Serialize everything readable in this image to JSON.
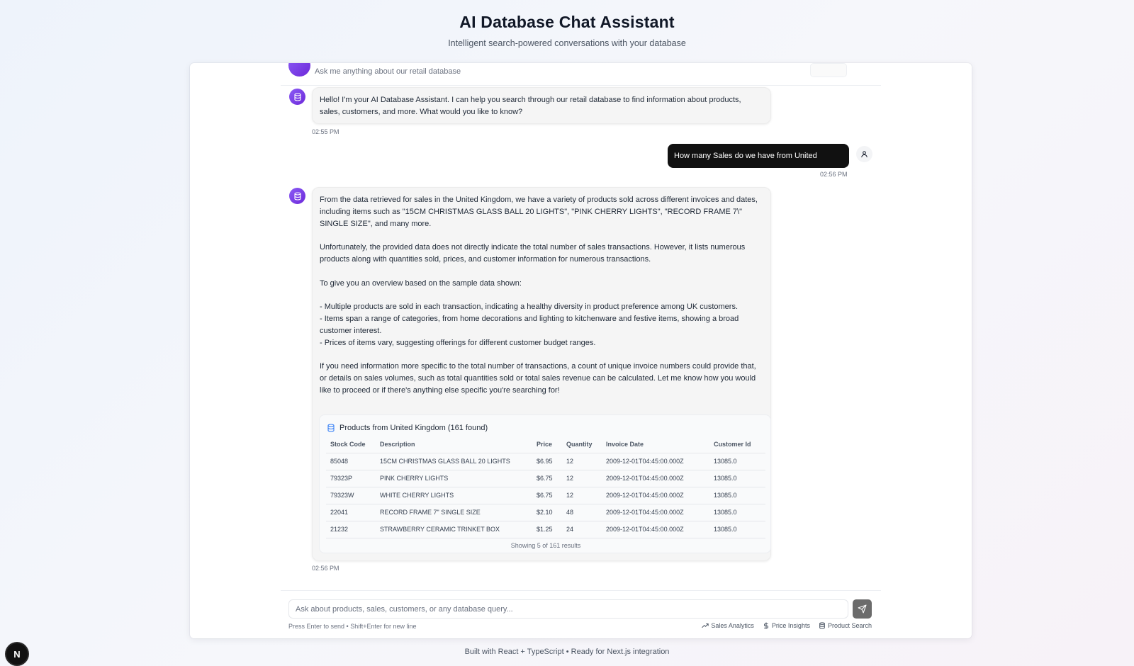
{
  "page": {
    "title": "AI Database Chat Assistant",
    "subtitle": "Intelligent search-powered conversations with your database",
    "footer": "Built with React + TypeScript • Ready for Next.js integration",
    "badge_letter": "N"
  },
  "chat_header": {
    "subtitle": "Ask me anything about our retail database"
  },
  "messages": {
    "greeting": {
      "text": "Hello! I'm your AI Database Assistant. I can help you search through our retail database to find information about products, sales, customers, and more. What would you like to know?",
      "time": "02:55 PM"
    },
    "user": {
      "text": "How many Sales do we have from United Kingdom",
      "time": "02:56 PM"
    },
    "answer": {
      "p1": "From the data retrieved for sales in the United Kingdom, we have a variety of products sold across different invoices and dates, including items such as \"15CM CHRISTMAS GLASS BALL 20 LIGHTS\", \"PINK CHERRY LIGHTS\", \"RECORD FRAME 7\\\" SINGLE SIZE\", and many more.",
      "p2": "Unfortunately, the provided data does not directly indicate the total number of sales transactions. However, it lists numerous products along with quantities sold, prices, and customer information for numerous transactions.",
      "p3": "To give you an overview based on the sample data shown:",
      "p4": "- Multiple products are sold in each transaction, indicating a healthy diversity in product preference among UK customers.\n- Items span a range of categories, from home decorations and lighting to kitchenware and festive items, showing a broad customer interest.\n- Prices of items vary, suggesting offerings for different customer budget ranges.",
      "p5": "If you need information more specific to the total number of transactions, a count of unique invoice numbers could provide that, or details on sales volumes, such as total quantities sold or total sales revenue can be calculated. Let me know how you would like to proceed or if there's anything else specific you're searching for!",
      "time": "02:56 PM"
    }
  },
  "results": {
    "title": "Products from United Kingdom (161 found)",
    "columns": [
      "Stock Code",
      "Description",
      "Price",
      "Quantity",
      "Invoice Date",
      "Customer Id"
    ],
    "rows": [
      [
        "85048",
        "15CM CHRISTMAS GLASS BALL 20 LIGHTS",
        "$6.95",
        "12",
        "2009-12-01T04:45:00.000Z",
        "13085.0"
      ],
      [
        "79323P",
        "PINK CHERRY LIGHTS",
        "$6.75",
        "12",
        "2009-12-01T04:45:00.000Z",
        "13085.0"
      ],
      [
        "79323W",
        "WHITE CHERRY LIGHTS",
        "$6.75",
        "12",
        "2009-12-01T04:45:00.000Z",
        "13085.0"
      ],
      [
        "22041",
        "RECORD FRAME 7\" SINGLE SIZE",
        "$2.10",
        "48",
        "2009-12-01T04:45:00.000Z",
        "13085.0"
      ],
      [
        "21232",
        "STRAWBERRY CERAMIC TRINKET BOX",
        "$1.25",
        "24",
        "2009-12-01T04:45:00.000Z",
        "13085.0"
      ]
    ],
    "footer": "Showing 5 of 161 results"
  },
  "input": {
    "placeholder": "Ask about products, sales, customers, or any database query...",
    "value": "",
    "hint": "Press Enter to send • Shift+Enter for new line"
  },
  "quick_actions": {
    "sales": "Sales Analytics",
    "price": "Price Insights",
    "product": "Product Search"
  },
  "icons": {
    "bot": "database-icon",
    "user": "user-icon",
    "send": "send-icon",
    "sales": "trending-up-icon",
    "price": "dollar-icon",
    "product": "database-icon"
  },
  "colors": {
    "accent": "#7c3aed",
    "user_bubble": "#111111",
    "send_button": "#6b6b6b",
    "table_icon": "#3b82f6"
  }
}
